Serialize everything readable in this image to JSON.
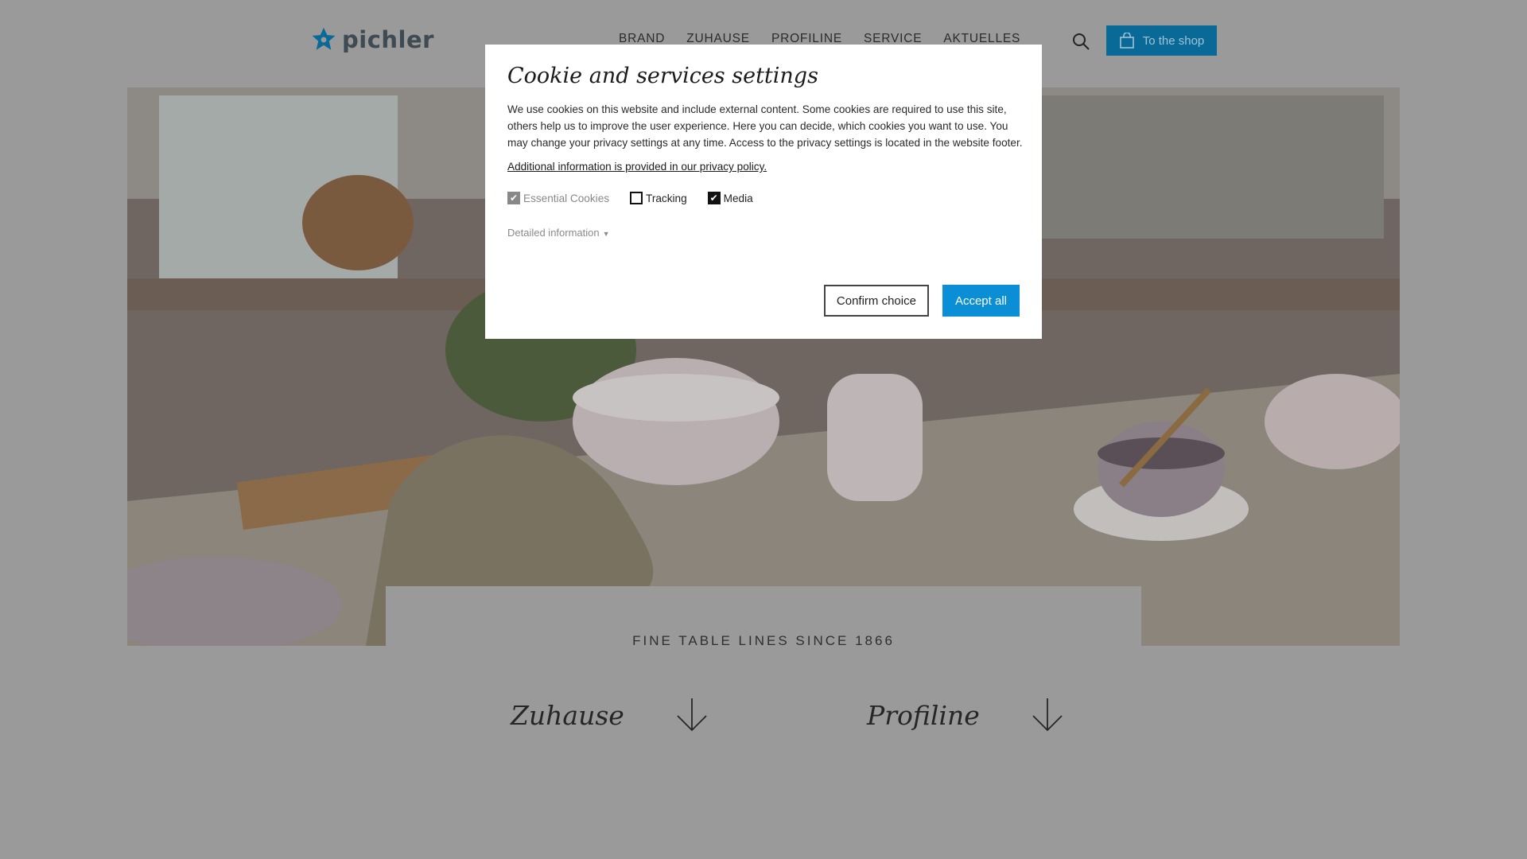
{
  "brand": {
    "name": "pichler"
  },
  "nav": {
    "items": [
      "BRAND",
      "ZUHAUSE",
      "PROFILINE",
      "SERVICE",
      "AKTUELLES"
    ]
  },
  "header": {
    "shop_label": "To the shop"
  },
  "hero": {
    "tagline": "FINE TABLE LINES SINCE 1866",
    "categories": [
      "Zuhause",
      "Profiline"
    ]
  },
  "cookie": {
    "title": "Cookie and services settings",
    "body": "We use cookies on this website and include external content. Some cookies are required to use this site, others help us to improve the user experience. Here you can decide, which cookies you want to use. You may change your privacy settings at any time. Access to the privacy settings is located in the website footer.",
    "policy_link": "Additional information is provided in our privacy policy.",
    "options": [
      {
        "label": "Essential Cookies",
        "checked": true,
        "disabled": true
      },
      {
        "label": "Tracking",
        "checked": false,
        "disabled": false
      },
      {
        "label": "Media",
        "checked": true,
        "disabled": false
      }
    ],
    "detail_label": "Detailed information",
    "confirm_label": "Confirm choice",
    "accept_label": "Accept all"
  },
  "colors": {
    "accent": "#0a8fd6",
    "shop_button": "#0a6a97",
    "overlay": "#9a9a9a"
  }
}
